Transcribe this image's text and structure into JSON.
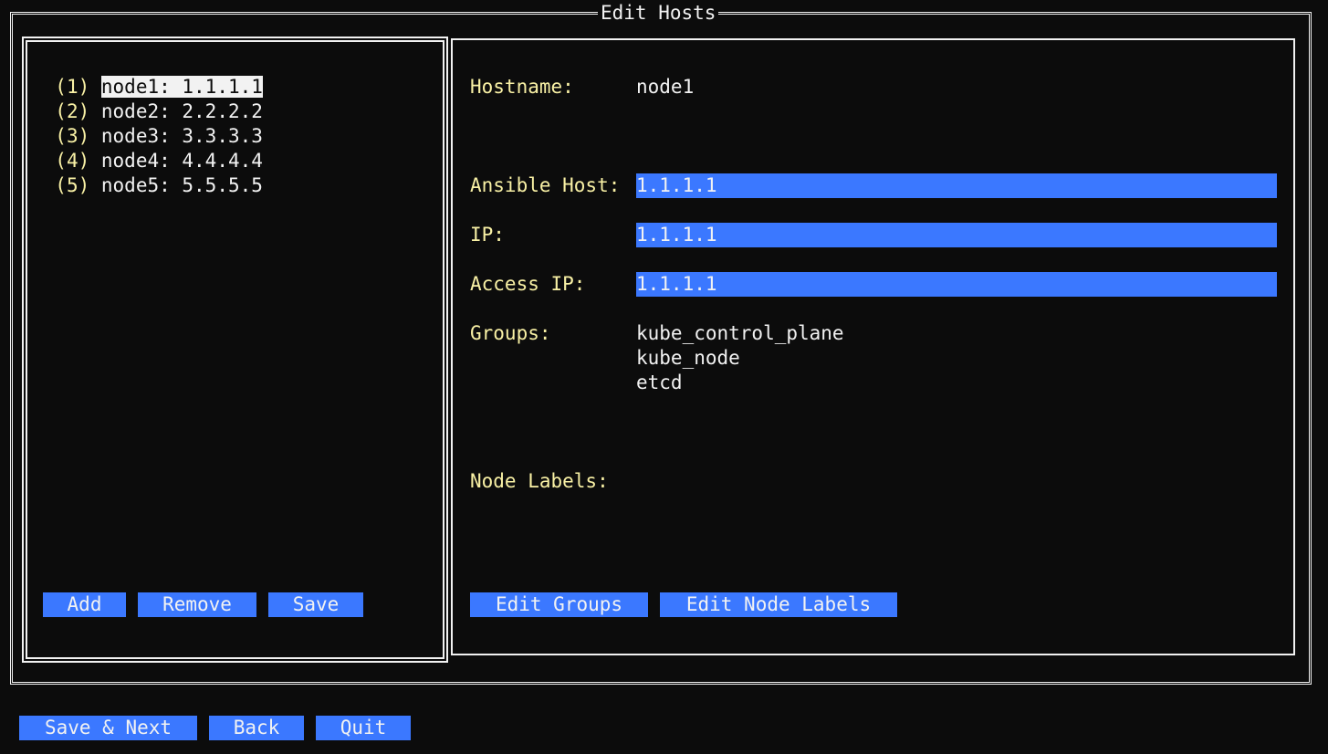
{
  "window": {
    "title": "Edit Hosts"
  },
  "hosts": [
    {
      "num": "(1)",
      "text": "node1: 1.1.1.1",
      "selected": true
    },
    {
      "num": "(2)",
      "text": "node2: 2.2.2.2"
    },
    {
      "num": "(3)",
      "text": "node3: 3.3.3.3"
    },
    {
      "num": "(4)",
      "text": "node4: 4.4.4.4"
    },
    {
      "num": "(5)",
      "text": "node5: 5.5.5.5"
    }
  ],
  "host_buttons": {
    "add": "Add",
    "remove": "Remove",
    "save": "Save"
  },
  "details": {
    "hostname_label": "Hostname:",
    "hostname_value": "node1",
    "ansible_host_label": "Ansible Host:",
    "ansible_host_value": "1.1.1.1",
    "ip_label": "IP:",
    "ip_value": "1.1.1.1",
    "access_ip_label": "Access IP:",
    "access_ip_value": "1.1.1.1",
    "groups_label": "Groups:",
    "groups": [
      "kube_control_plane",
      "kube_node",
      "etcd"
    ],
    "node_labels_label": "Node Labels:"
  },
  "detail_buttons": {
    "edit_groups": "Edit Groups",
    "edit_node_labels": "Edit Node Labels"
  },
  "footer_buttons": {
    "save_next": "Save & Next",
    "back": "Back",
    "quit": "Quit"
  },
  "colors": {
    "background": "#0c0c0c",
    "foreground": "#f2f2f2",
    "label_yellow": "#f9f1a5",
    "accent_blue": "#3b78ff"
  }
}
